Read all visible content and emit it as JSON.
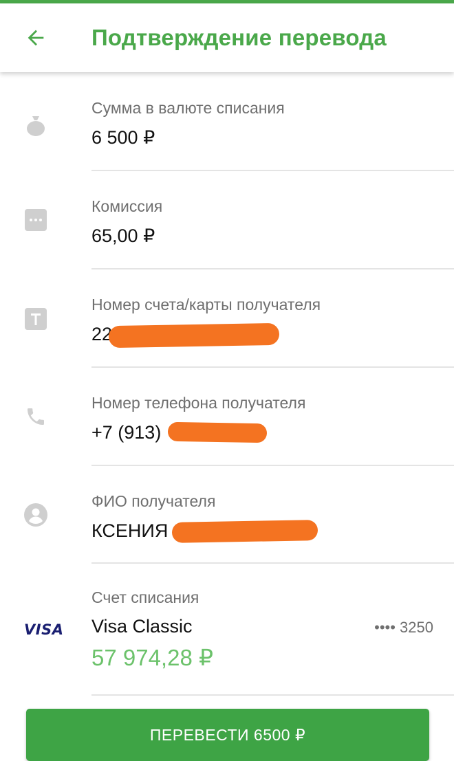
{
  "header": {
    "title": "Подтверждение перевода",
    "back_icon": "arrow-left-icon"
  },
  "colors": {
    "accent": "#4aa84a",
    "balance": "#6cc26b",
    "button": "#3ea445",
    "redaction": "#f47321"
  },
  "fields": {
    "amount": {
      "icon": "money-bag-icon",
      "label": "Сумма в валюте списания",
      "value": "6 500 ₽"
    },
    "commission": {
      "icon": "more-dots-icon",
      "label": "Комиссия",
      "value": "65,00 ₽"
    },
    "account": {
      "icon": "text-t-icon",
      "label": "Номер счета/карты получателя",
      "value": "22"
    },
    "phone": {
      "icon": "phone-icon",
      "label": "Номер телефона получателя",
      "value": "+7 (913)"
    },
    "name": {
      "icon": "person-icon",
      "label": "ФИО получателя",
      "value": "КСЕНИЯ"
    }
  },
  "source": {
    "label": "Счет списания",
    "brand": "VISA",
    "card_name": "Visa Classic",
    "card_number": "•••• 3250",
    "balance": "57 974,28 ₽"
  },
  "action": {
    "confirm_label": "ПЕРЕВЕСТИ 6500 ₽"
  }
}
